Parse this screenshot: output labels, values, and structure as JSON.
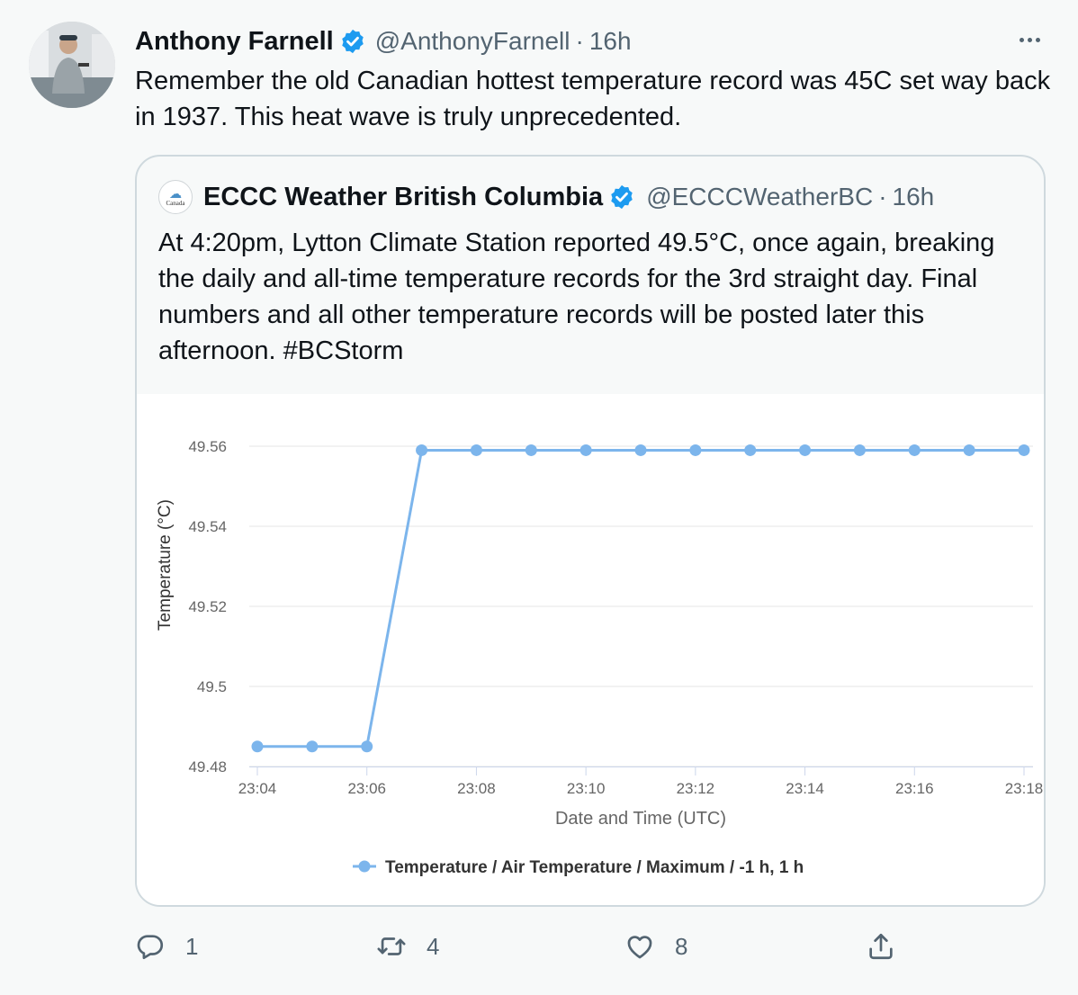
{
  "tweet": {
    "author_name": "Anthony Farnell",
    "author_handle": "@AnthonyFarnell",
    "separator": "·",
    "time": "16h",
    "text": "Remember the old Canadian hottest temperature record was 45C set way back in 1937. This heat wave is truly unprecedented."
  },
  "quote": {
    "author_name": "ECCC Weather British Columbia",
    "author_handle": "@ECCCWeatherBC",
    "separator": "·",
    "time": "16h",
    "text": "At 4:20pm, Lytton Climate Station reported 49.5°C, once again, breaking the daily and all-time temperature records for the 3rd straight day. Final numbers and all other temperature records will be posted later this afternoon. #BCStorm",
    "avatar_label": "Canada"
  },
  "chart_data": {
    "type": "line",
    "title": "",
    "xlabel": "Date and Time (UTC)",
    "ylabel": "Temperature (°C)",
    "x_ticks": [
      "23:04",
      "23:06",
      "23:08",
      "23:10",
      "23:12",
      "23:14",
      "23:16",
      "23:18"
    ],
    "y_ticks": [
      "49.56",
      "49.54",
      "49.52",
      "49.5",
      "49.48"
    ],
    "ylim": [
      49.48,
      49.56
    ],
    "grid": true,
    "legend_position": "bottom",
    "series": [
      {
        "name": "Temperature / Air Temperature / Maximum / -1 h, 1 h",
        "color": "#7cb5ec",
        "x": [
          "23:04",
          "23:05",
          "23:06",
          "23:07",
          "23:08",
          "23:09",
          "23:10",
          "23:11",
          "23:12",
          "23:13",
          "23:14",
          "23:15",
          "23:16",
          "23:17",
          "23:18"
        ],
        "values": [
          49.485,
          49.485,
          49.485,
          49.559,
          49.559,
          49.559,
          49.559,
          49.559,
          49.559,
          49.559,
          49.559,
          49.559,
          49.559,
          49.559,
          49.559
        ]
      }
    ]
  },
  "actions": {
    "reply_count": "1",
    "retweet_count": "4",
    "like_count": "8"
  },
  "colors": {
    "verified": "#1d9bf0",
    "muted_text": "#536471",
    "series": "#7cb5ec"
  },
  "icons": [
    "verified-badge-icon",
    "more-icon",
    "reply-icon",
    "retweet-icon",
    "like-icon",
    "share-icon"
  ]
}
